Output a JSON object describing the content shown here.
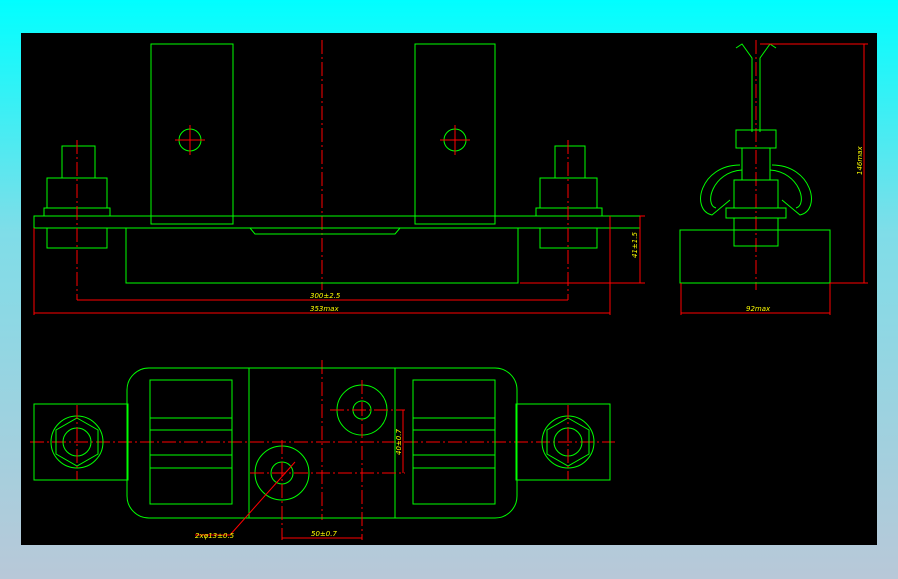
{
  "drawing": {
    "dimensions": {
      "pitch": "300±2.5",
      "overall_length": "353max",
      "base_height": "41±1.5",
      "overall_height": "146max",
      "width": "92max",
      "holes": "2xφ13±0.5",
      "hole_spacing_x": "50±0.7",
      "hole_spacing_y": "40±0.7"
    },
    "colors": {
      "outline": "#00ff00",
      "centerline": "#ff0000",
      "text": "#ffff00",
      "background": "#000000"
    }
  }
}
